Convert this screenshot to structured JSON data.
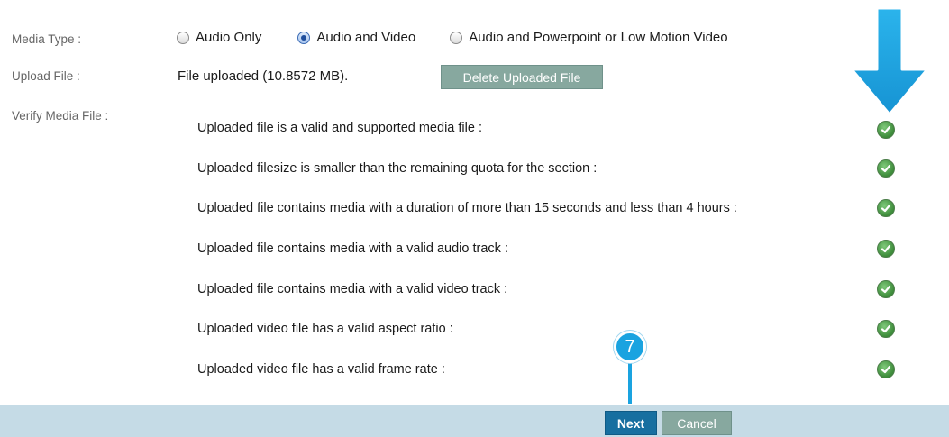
{
  "labels": {
    "media_type": "Media Type :",
    "upload_file": "Upload File :",
    "verify_media_file": "Verify Media File :"
  },
  "media_type": {
    "options": [
      {
        "label": "Audio Only",
        "selected": false
      },
      {
        "label": "Audio and Video",
        "selected": true
      },
      {
        "label": "Audio and Powerpoint or Low Motion Video",
        "selected": false
      }
    ]
  },
  "upload": {
    "status_text": "File uploaded (10.8572 MB).",
    "delete_label": "Delete Uploaded File"
  },
  "checks": [
    {
      "text": "Uploaded file is a valid and supported media file :",
      "status": "passed"
    },
    {
      "text": "Uploaded filesize is smaller than the remaining quota for the section :",
      "status": "passed"
    },
    {
      "text": "Uploaded file contains media with a duration of more than 15 seconds and less than 4 hours :",
      "status": "passed"
    },
    {
      "text": "Uploaded file contains media with a valid audio track :",
      "status": "passed"
    },
    {
      "text": "Uploaded file contains media with a valid video track :",
      "status": "passed"
    },
    {
      "text": "Uploaded video file has a valid aspect ratio :",
      "status": "passed"
    },
    {
      "text": "Uploaded video file has a valid frame rate :",
      "status": "passed"
    }
  ],
  "footer": {
    "next_label": "Next",
    "cancel_label": "Cancel"
  },
  "annotation": {
    "step_number": "7",
    "arrow_icon": "down-arrow-icon",
    "color": "#1aa3e0"
  },
  "colors": {
    "primary_button": "#176fa0",
    "secondary_button": "#87a89f",
    "footer_bar": "#c5dbe6",
    "check_green": "#3d8b3a"
  }
}
